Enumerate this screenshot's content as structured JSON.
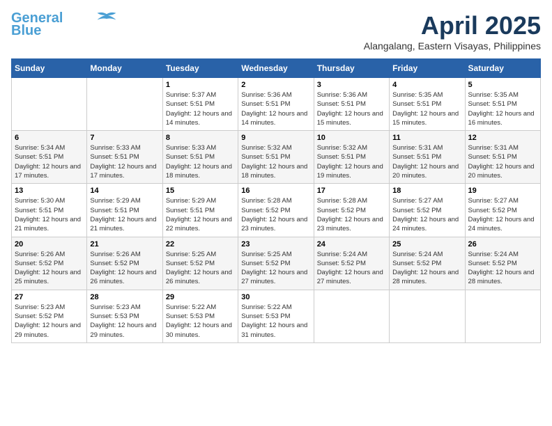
{
  "logo": {
    "line1": "General",
    "line2": "Blue"
  },
  "title": "April 2025",
  "location": "Alangalang, Eastern Visayas, Philippines",
  "days_of_week": [
    "Sunday",
    "Monday",
    "Tuesday",
    "Wednesday",
    "Thursday",
    "Friday",
    "Saturday"
  ],
  "weeks": [
    [
      {
        "day": "",
        "info": ""
      },
      {
        "day": "",
        "info": ""
      },
      {
        "day": "1",
        "info": "Sunrise: 5:37 AM\nSunset: 5:51 PM\nDaylight: 12 hours and 14 minutes."
      },
      {
        "day": "2",
        "info": "Sunrise: 5:36 AM\nSunset: 5:51 PM\nDaylight: 12 hours and 14 minutes."
      },
      {
        "day": "3",
        "info": "Sunrise: 5:36 AM\nSunset: 5:51 PM\nDaylight: 12 hours and 15 minutes."
      },
      {
        "day": "4",
        "info": "Sunrise: 5:35 AM\nSunset: 5:51 PM\nDaylight: 12 hours and 15 minutes."
      },
      {
        "day": "5",
        "info": "Sunrise: 5:35 AM\nSunset: 5:51 PM\nDaylight: 12 hours and 16 minutes."
      }
    ],
    [
      {
        "day": "6",
        "info": "Sunrise: 5:34 AM\nSunset: 5:51 PM\nDaylight: 12 hours and 17 minutes."
      },
      {
        "day": "7",
        "info": "Sunrise: 5:33 AM\nSunset: 5:51 PM\nDaylight: 12 hours and 17 minutes."
      },
      {
        "day": "8",
        "info": "Sunrise: 5:33 AM\nSunset: 5:51 PM\nDaylight: 12 hours and 18 minutes."
      },
      {
        "day": "9",
        "info": "Sunrise: 5:32 AM\nSunset: 5:51 PM\nDaylight: 12 hours and 18 minutes."
      },
      {
        "day": "10",
        "info": "Sunrise: 5:32 AM\nSunset: 5:51 PM\nDaylight: 12 hours and 19 minutes."
      },
      {
        "day": "11",
        "info": "Sunrise: 5:31 AM\nSunset: 5:51 PM\nDaylight: 12 hours and 20 minutes."
      },
      {
        "day": "12",
        "info": "Sunrise: 5:31 AM\nSunset: 5:51 PM\nDaylight: 12 hours and 20 minutes."
      }
    ],
    [
      {
        "day": "13",
        "info": "Sunrise: 5:30 AM\nSunset: 5:51 PM\nDaylight: 12 hours and 21 minutes."
      },
      {
        "day": "14",
        "info": "Sunrise: 5:29 AM\nSunset: 5:51 PM\nDaylight: 12 hours and 21 minutes."
      },
      {
        "day": "15",
        "info": "Sunrise: 5:29 AM\nSunset: 5:51 PM\nDaylight: 12 hours and 22 minutes."
      },
      {
        "day": "16",
        "info": "Sunrise: 5:28 AM\nSunset: 5:52 PM\nDaylight: 12 hours and 23 minutes."
      },
      {
        "day": "17",
        "info": "Sunrise: 5:28 AM\nSunset: 5:52 PM\nDaylight: 12 hours and 23 minutes."
      },
      {
        "day": "18",
        "info": "Sunrise: 5:27 AM\nSunset: 5:52 PM\nDaylight: 12 hours and 24 minutes."
      },
      {
        "day": "19",
        "info": "Sunrise: 5:27 AM\nSunset: 5:52 PM\nDaylight: 12 hours and 24 minutes."
      }
    ],
    [
      {
        "day": "20",
        "info": "Sunrise: 5:26 AM\nSunset: 5:52 PM\nDaylight: 12 hours and 25 minutes."
      },
      {
        "day": "21",
        "info": "Sunrise: 5:26 AM\nSunset: 5:52 PM\nDaylight: 12 hours and 26 minutes."
      },
      {
        "day": "22",
        "info": "Sunrise: 5:25 AM\nSunset: 5:52 PM\nDaylight: 12 hours and 26 minutes."
      },
      {
        "day": "23",
        "info": "Sunrise: 5:25 AM\nSunset: 5:52 PM\nDaylight: 12 hours and 27 minutes."
      },
      {
        "day": "24",
        "info": "Sunrise: 5:24 AM\nSunset: 5:52 PM\nDaylight: 12 hours and 27 minutes."
      },
      {
        "day": "25",
        "info": "Sunrise: 5:24 AM\nSunset: 5:52 PM\nDaylight: 12 hours and 28 minutes."
      },
      {
        "day": "26",
        "info": "Sunrise: 5:24 AM\nSunset: 5:52 PM\nDaylight: 12 hours and 28 minutes."
      }
    ],
    [
      {
        "day": "27",
        "info": "Sunrise: 5:23 AM\nSunset: 5:52 PM\nDaylight: 12 hours and 29 minutes."
      },
      {
        "day": "28",
        "info": "Sunrise: 5:23 AM\nSunset: 5:53 PM\nDaylight: 12 hours and 29 minutes."
      },
      {
        "day": "29",
        "info": "Sunrise: 5:22 AM\nSunset: 5:53 PM\nDaylight: 12 hours and 30 minutes."
      },
      {
        "day": "30",
        "info": "Sunrise: 5:22 AM\nSunset: 5:53 PM\nDaylight: 12 hours and 31 minutes."
      },
      {
        "day": "",
        "info": ""
      },
      {
        "day": "",
        "info": ""
      },
      {
        "day": "",
        "info": ""
      }
    ]
  ]
}
